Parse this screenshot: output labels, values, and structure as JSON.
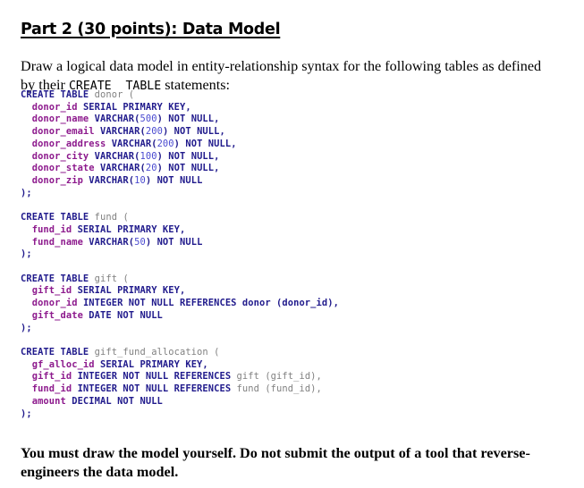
{
  "heading": {
    "text": "Part 2 (30 points): Data Model"
  },
  "intro": {
    "before_code": "Draw a logical data model in entity-relationship syntax for the following tables as defined by their ",
    "inline_code": "CREATE  TABLE",
    "after_code": " statements:"
  },
  "colors": {
    "keyword": "#201a8c",
    "identifier": "#8d1a8d",
    "table_name": "#808080",
    "number": "#4a4ad0",
    "text": "#000000",
    "background": "#ffffff"
  },
  "sql_blocks": [
    {
      "name": "donor",
      "lines": [
        [
          {
            "t": "CREATE TABLE",
            "c": "kw"
          },
          {
            "t": " ",
            "c": "plain"
          },
          {
            "t": "donor",
            "c": "tbl"
          },
          {
            "t": " ",
            "c": "plain"
          },
          {
            "t": "(",
            "c": "tbl"
          }
        ],
        [
          {
            "t": "  ",
            "c": "plain"
          },
          {
            "t": "donor_id",
            "c": "ident"
          },
          {
            "t": " ",
            "c": "plain"
          },
          {
            "t": "SERIAL PRIMARY KEY,",
            "c": "kw"
          }
        ],
        [
          {
            "t": "  ",
            "c": "plain"
          },
          {
            "t": "donor_name",
            "c": "ident"
          },
          {
            "t": " ",
            "c": "plain"
          },
          {
            "t": "VARCHAR",
            "c": "kw"
          },
          {
            "t": "(",
            "c": "kw"
          },
          {
            "t": "500",
            "c": "num"
          },
          {
            "t": ")",
            "c": "kw"
          },
          {
            "t": " ",
            "c": "plain"
          },
          {
            "t": "NOT NULL,",
            "c": "kw"
          }
        ],
        [
          {
            "t": "  ",
            "c": "plain"
          },
          {
            "t": "donor_email",
            "c": "ident"
          },
          {
            "t": " ",
            "c": "plain"
          },
          {
            "t": "VARCHAR",
            "c": "kw"
          },
          {
            "t": "(",
            "c": "kw"
          },
          {
            "t": "200",
            "c": "num"
          },
          {
            "t": ")",
            "c": "kw"
          },
          {
            "t": " ",
            "c": "plain"
          },
          {
            "t": "NOT NULL,",
            "c": "kw"
          }
        ],
        [
          {
            "t": "  ",
            "c": "plain"
          },
          {
            "t": "donor_address",
            "c": "ident"
          },
          {
            "t": " ",
            "c": "plain"
          },
          {
            "t": "VARCHAR",
            "c": "kw"
          },
          {
            "t": "(",
            "c": "kw"
          },
          {
            "t": "200",
            "c": "num"
          },
          {
            "t": ")",
            "c": "kw"
          },
          {
            "t": " ",
            "c": "plain"
          },
          {
            "t": "NOT NULL,",
            "c": "kw"
          }
        ],
        [
          {
            "t": "  ",
            "c": "plain"
          },
          {
            "t": "donor_city",
            "c": "ident"
          },
          {
            "t": " ",
            "c": "plain"
          },
          {
            "t": "VARCHAR",
            "c": "kw"
          },
          {
            "t": "(",
            "c": "kw"
          },
          {
            "t": "100",
            "c": "num"
          },
          {
            "t": ")",
            "c": "kw"
          },
          {
            "t": " ",
            "c": "plain"
          },
          {
            "t": "NOT NULL,",
            "c": "kw"
          }
        ],
        [
          {
            "t": "  ",
            "c": "plain"
          },
          {
            "t": "donor_state",
            "c": "ident"
          },
          {
            "t": " ",
            "c": "plain"
          },
          {
            "t": "VARCHAR",
            "c": "kw"
          },
          {
            "t": "(",
            "c": "kw"
          },
          {
            "t": "20",
            "c": "num"
          },
          {
            "t": ")",
            "c": "kw"
          },
          {
            "t": " ",
            "c": "plain"
          },
          {
            "t": "NOT NULL,",
            "c": "kw"
          }
        ],
        [
          {
            "t": "  ",
            "c": "plain"
          },
          {
            "t": "donor_zip",
            "c": "ident"
          },
          {
            "t": " ",
            "c": "plain"
          },
          {
            "t": "VARCHAR",
            "c": "kw"
          },
          {
            "t": "(",
            "c": "kw"
          },
          {
            "t": "10",
            "c": "num"
          },
          {
            "t": ")",
            "c": "kw"
          },
          {
            "t": " ",
            "c": "plain"
          },
          {
            "t": "NOT NULL",
            "c": "kw"
          }
        ],
        [
          {
            "t": ");",
            "c": "punc"
          }
        ]
      ]
    },
    {
      "name": "fund",
      "lines": [
        [
          {
            "t": "CREATE TABLE",
            "c": "kw"
          },
          {
            "t": " ",
            "c": "plain"
          },
          {
            "t": "fund",
            "c": "tbl"
          },
          {
            "t": " ",
            "c": "plain"
          },
          {
            "t": "(",
            "c": "tbl"
          }
        ],
        [
          {
            "t": "  ",
            "c": "plain"
          },
          {
            "t": "fund_id",
            "c": "ident"
          },
          {
            "t": " ",
            "c": "plain"
          },
          {
            "t": "SERIAL PRIMARY KEY,",
            "c": "kw"
          }
        ],
        [
          {
            "t": "  ",
            "c": "plain"
          },
          {
            "t": "fund_name",
            "c": "ident"
          },
          {
            "t": " ",
            "c": "plain"
          },
          {
            "t": "VARCHAR",
            "c": "kw"
          },
          {
            "t": "(",
            "c": "kw"
          },
          {
            "t": "50",
            "c": "num"
          },
          {
            "t": ")",
            "c": "kw"
          },
          {
            "t": " ",
            "c": "plain"
          },
          {
            "t": "NOT NULL",
            "c": "kw"
          }
        ],
        [
          {
            "t": ");",
            "c": "punc"
          }
        ]
      ]
    },
    {
      "name": "gift",
      "lines": [
        [
          {
            "t": "CREATE TABLE",
            "c": "kw"
          },
          {
            "t": " ",
            "c": "plain"
          },
          {
            "t": "gift",
            "c": "tbl"
          },
          {
            "t": " ",
            "c": "plain"
          },
          {
            "t": "(",
            "c": "tbl"
          }
        ],
        [
          {
            "t": "  ",
            "c": "plain"
          },
          {
            "t": "gift_id",
            "c": "ident"
          },
          {
            "t": " ",
            "c": "plain"
          },
          {
            "t": "SERIAL PRIMARY KEY,",
            "c": "kw"
          }
        ],
        [
          {
            "t": "  ",
            "c": "plain"
          },
          {
            "t": "donor_id",
            "c": "ident"
          },
          {
            "t": " ",
            "c": "plain"
          },
          {
            "t": "INTEGER NOT NULL REFERENCES donor (donor_id),",
            "c": "kw"
          }
        ],
        [
          {
            "t": "  ",
            "c": "plain"
          },
          {
            "t": "gift_date",
            "c": "ident"
          },
          {
            "t": " ",
            "c": "plain"
          },
          {
            "t": "DATE NOT NULL",
            "c": "kw"
          }
        ],
        [
          {
            "t": ");",
            "c": "punc"
          }
        ]
      ]
    },
    {
      "name": "gift_fund_allocation",
      "lines": [
        [
          {
            "t": "CREATE TABLE",
            "c": "kw"
          },
          {
            "t": " ",
            "c": "plain"
          },
          {
            "t": "gift_fund_allocation",
            "c": "tbl"
          },
          {
            "t": " ",
            "c": "plain"
          },
          {
            "t": "(",
            "c": "tbl"
          }
        ],
        [
          {
            "t": "  ",
            "c": "plain"
          },
          {
            "t": "gf_alloc_id",
            "c": "ident"
          },
          {
            "t": " ",
            "c": "plain"
          },
          {
            "t": "SERIAL PRIMARY KEY,",
            "c": "kw"
          }
        ],
        [
          {
            "t": "  ",
            "c": "plain"
          },
          {
            "t": "gift_id",
            "c": "ident"
          },
          {
            "t": " ",
            "c": "plain"
          },
          {
            "t": "INTEGER NOT NULL REFERENCES",
            "c": "kw"
          },
          {
            "t": " ",
            "c": "plain"
          },
          {
            "t": "gift (gift_id),",
            "c": "tbl"
          }
        ],
        [
          {
            "t": "  ",
            "c": "plain"
          },
          {
            "t": "fund_id",
            "c": "ident"
          },
          {
            "t": " ",
            "c": "plain"
          },
          {
            "t": "INTEGER NOT NULL REFERENCES",
            "c": "kw"
          },
          {
            "t": " ",
            "c": "plain"
          },
          {
            "t": "fund (fund_id),",
            "c": "tbl"
          }
        ],
        [
          {
            "t": "  ",
            "c": "plain"
          },
          {
            "t": "amount",
            "c": "ident"
          },
          {
            "t": " ",
            "c": "plain"
          },
          {
            "t": "DECIMAL NOT NULL",
            "c": "kw"
          }
        ],
        [
          {
            "t": ");",
            "c": "punc"
          }
        ]
      ]
    }
  ],
  "footer_note": {
    "text": "You must draw the model yourself. Do not submit the output of a tool that reverse-engineers the data model."
  }
}
